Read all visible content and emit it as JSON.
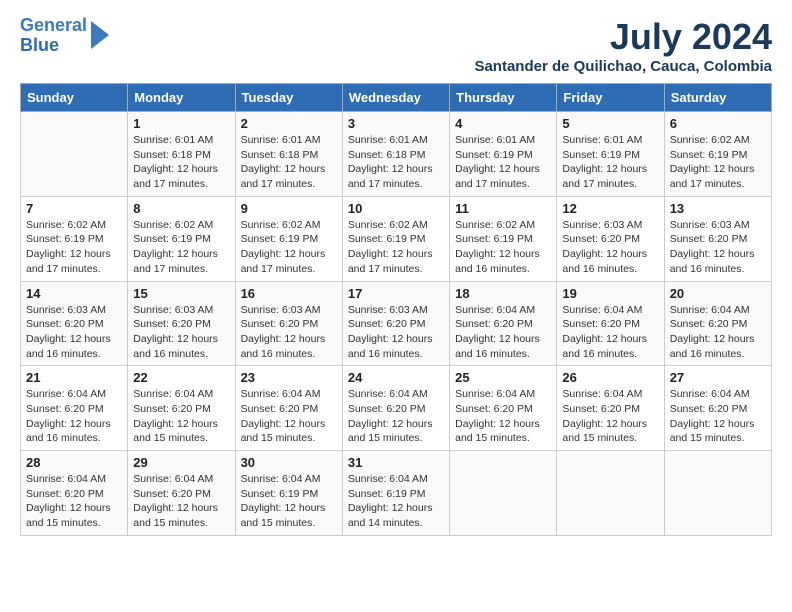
{
  "header": {
    "logo_line1": "General",
    "logo_line2": "Blue",
    "month_year": "July 2024",
    "location": "Santander de Quilichao, Cauca, Colombia"
  },
  "days_of_week": [
    "Sunday",
    "Monday",
    "Tuesday",
    "Wednesday",
    "Thursday",
    "Friday",
    "Saturday"
  ],
  "weeks": [
    [
      {
        "day": "",
        "info": ""
      },
      {
        "day": "1",
        "info": "Sunrise: 6:01 AM\nSunset: 6:18 PM\nDaylight: 12 hours\nand 17 minutes."
      },
      {
        "day": "2",
        "info": "Sunrise: 6:01 AM\nSunset: 6:18 PM\nDaylight: 12 hours\nand 17 minutes."
      },
      {
        "day": "3",
        "info": "Sunrise: 6:01 AM\nSunset: 6:18 PM\nDaylight: 12 hours\nand 17 minutes."
      },
      {
        "day": "4",
        "info": "Sunrise: 6:01 AM\nSunset: 6:19 PM\nDaylight: 12 hours\nand 17 minutes."
      },
      {
        "day": "5",
        "info": "Sunrise: 6:01 AM\nSunset: 6:19 PM\nDaylight: 12 hours\nand 17 minutes."
      },
      {
        "day": "6",
        "info": "Sunrise: 6:02 AM\nSunset: 6:19 PM\nDaylight: 12 hours\nand 17 minutes."
      }
    ],
    [
      {
        "day": "7",
        "info": "Sunrise: 6:02 AM\nSunset: 6:19 PM\nDaylight: 12 hours\nand 17 minutes."
      },
      {
        "day": "8",
        "info": "Sunrise: 6:02 AM\nSunset: 6:19 PM\nDaylight: 12 hours\nand 17 minutes."
      },
      {
        "day": "9",
        "info": "Sunrise: 6:02 AM\nSunset: 6:19 PM\nDaylight: 12 hours\nand 17 minutes."
      },
      {
        "day": "10",
        "info": "Sunrise: 6:02 AM\nSunset: 6:19 PM\nDaylight: 12 hours\nand 17 minutes."
      },
      {
        "day": "11",
        "info": "Sunrise: 6:02 AM\nSunset: 6:19 PM\nDaylight: 12 hours\nand 16 minutes."
      },
      {
        "day": "12",
        "info": "Sunrise: 6:03 AM\nSunset: 6:20 PM\nDaylight: 12 hours\nand 16 minutes."
      },
      {
        "day": "13",
        "info": "Sunrise: 6:03 AM\nSunset: 6:20 PM\nDaylight: 12 hours\nand 16 minutes."
      }
    ],
    [
      {
        "day": "14",
        "info": "Sunrise: 6:03 AM\nSunset: 6:20 PM\nDaylight: 12 hours\nand 16 minutes."
      },
      {
        "day": "15",
        "info": "Sunrise: 6:03 AM\nSunset: 6:20 PM\nDaylight: 12 hours\nand 16 minutes."
      },
      {
        "day": "16",
        "info": "Sunrise: 6:03 AM\nSunset: 6:20 PM\nDaylight: 12 hours\nand 16 minutes."
      },
      {
        "day": "17",
        "info": "Sunrise: 6:03 AM\nSunset: 6:20 PM\nDaylight: 12 hours\nand 16 minutes."
      },
      {
        "day": "18",
        "info": "Sunrise: 6:04 AM\nSunset: 6:20 PM\nDaylight: 12 hours\nand 16 minutes."
      },
      {
        "day": "19",
        "info": "Sunrise: 6:04 AM\nSunset: 6:20 PM\nDaylight: 12 hours\nand 16 minutes."
      },
      {
        "day": "20",
        "info": "Sunrise: 6:04 AM\nSunset: 6:20 PM\nDaylight: 12 hours\nand 16 minutes."
      }
    ],
    [
      {
        "day": "21",
        "info": "Sunrise: 6:04 AM\nSunset: 6:20 PM\nDaylight: 12 hours\nand 16 minutes."
      },
      {
        "day": "22",
        "info": "Sunrise: 6:04 AM\nSunset: 6:20 PM\nDaylight: 12 hours\nand 15 minutes."
      },
      {
        "day": "23",
        "info": "Sunrise: 6:04 AM\nSunset: 6:20 PM\nDaylight: 12 hours\nand 15 minutes."
      },
      {
        "day": "24",
        "info": "Sunrise: 6:04 AM\nSunset: 6:20 PM\nDaylight: 12 hours\nand 15 minutes."
      },
      {
        "day": "25",
        "info": "Sunrise: 6:04 AM\nSunset: 6:20 PM\nDaylight: 12 hours\nand 15 minutes."
      },
      {
        "day": "26",
        "info": "Sunrise: 6:04 AM\nSunset: 6:20 PM\nDaylight: 12 hours\nand 15 minutes."
      },
      {
        "day": "27",
        "info": "Sunrise: 6:04 AM\nSunset: 6:20 PM\nDaylight: 12 hours\nand 15 minutes."
      }
    ],
    [
      {
        "day": "28",
        "info": "Sunrise: 6:04 AM\nSunset: 6:20 PM\nDaylight: 12 hours\nand 15 minutes."
      },
      {
        "day": "29",
        "info": "Sunrise: 6:04 AM\nSunset: 6:20 PM\nDaylight: 12 hours\nand 15 minutes."
      },
      {
        "day": "30",
        "info": "Sunrise: 6:04 AM\nSunset: 6:19 PM\nDaylight: 12 hours\nand 15 minutes."
      },
      {
        "day": "31",
        "info": "Sunrise: 6:04 AM\nSunset: 6:19 PM\nDaylight: 12 hours\nand 14 minutes."
      },
      {
        "day": "",
        "info": ""
      },
      {
        "day": "",
        "info": ""
      },
      {
        "day": "",
        "info": ""
      }
    ]
  ]
}
